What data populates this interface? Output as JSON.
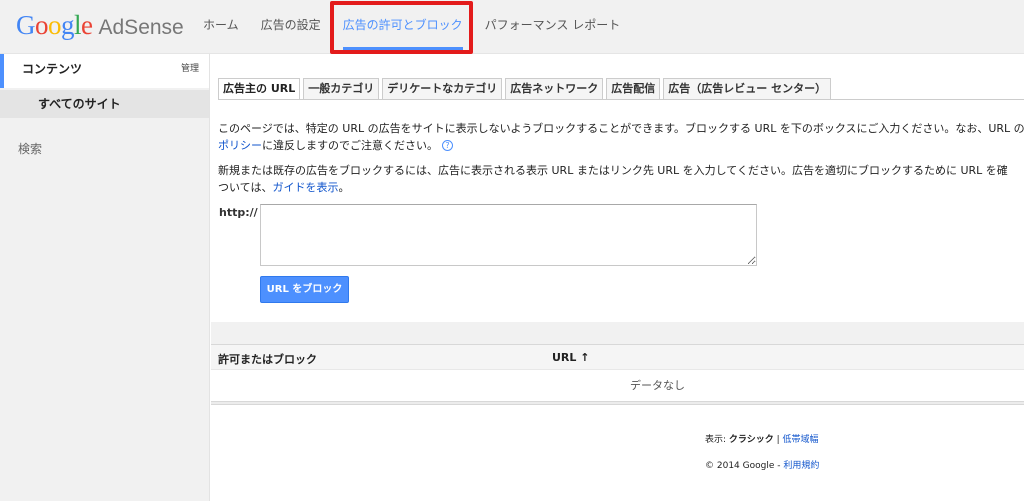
{
  "header": {
    "logo_google": "Google",
    "logo_product": "AdSense",
    "nav": [
      {
        "label": "ホーム"
      },
      {
        "label": "広告の設定"
      },
      {
        "label": "広告の許可とブロック"
      },
      {
        "label": "パフォーマンス レポート"
      }
    ],
    "active_nav_index": 2,
    "highlight_color": "#e31b1b"
  },
  "sidebar": {
    "content_label": "コンテンツ",
    "manage_label": "管理",
    "all_sites_label": "すべてのサイト",
    "search_label": "検索"
  },
  "main": {
    "tabs": [
      {
        "label": "広告主の URL"
      },
      {
        "label": "一般カテゴリ"
      },
      {
        "label": "デリケートなカテゴリ"
      },
      {
        "label": "広告ネットワーク"
      },
      {
        "label": "広告配信"
      },
      {
        "label": "広告（広告レビュー センター）"
      }
    ],
    "description1_text": "このページでは、特定の URL の広告をサイトに表示しないようブロックすることができます。ブロックする URL を下のボックスにご入力ください。なお、URL の",
    "description1_link": "ポリシー",
    "description1_tail": "に違反しますのでご注意ください。",
    "help_icon": "?",
    "description2_text": "新規または既存の広告をブロックするには、広告に表示される表示 URL またはリンク先 URL を入力してください。広告を適切にブロックするために URL を確",
    "description2_lead": "ついては、",
    "description2_link": "ガイドを表示",
    "description2_end": "。",
    "http_label": "http://",
    "url_input_value": "",
    "block_button_label": "URL をブロック",
    "table": {
      "col_status": "許可またはブロック",
      "col_url": "URL ↑",
      "empty_text": "データなし"
    },
    "footer": {
      "display_prefix": "表示: ",
      "display_classic": "クラシック",
      "separator": " | ",
      "display_low_bandwidth": "低帯域幅",
      "copyright": "© 2014 Google - ",
      "terms_link": "利用規約"
    }
  },
  "colors": {
    "accent": "#4d90fe",
    "link": "#1155cc"
  }
}
